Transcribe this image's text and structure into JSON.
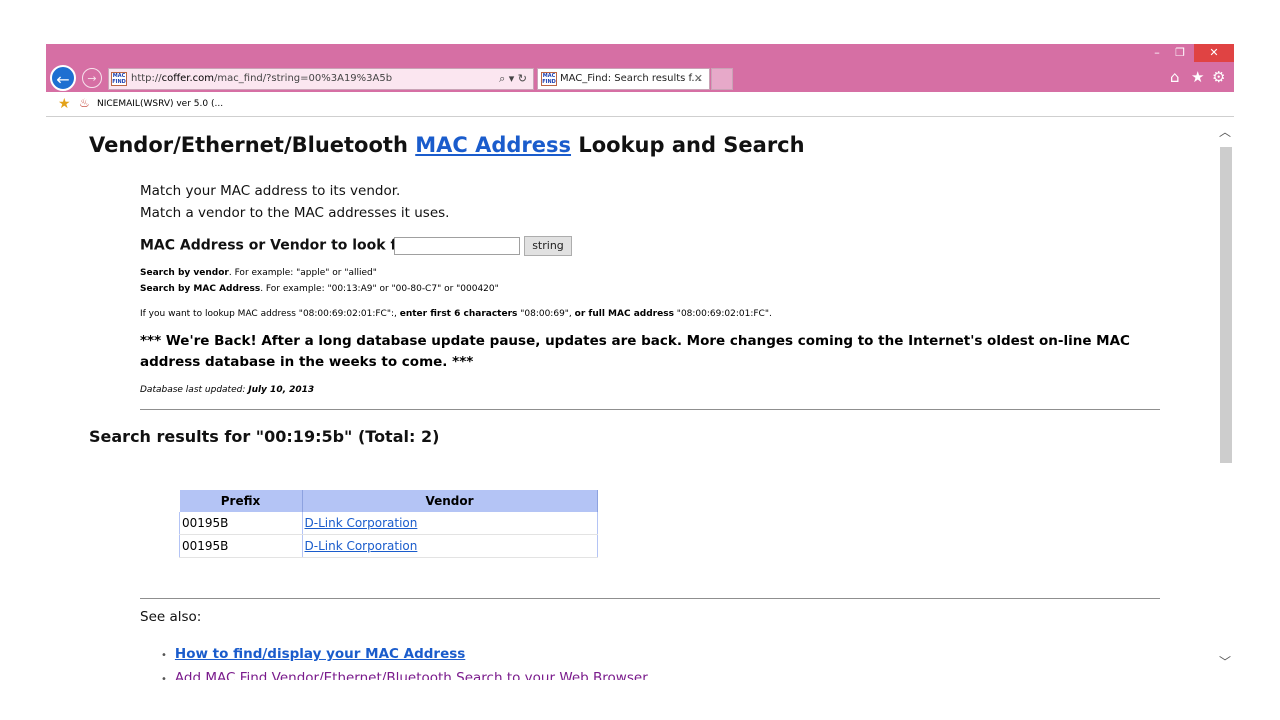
{
  "window": {
    "minimize": "–",
    "maximize": "❐",
    "close": "✕"
  },
  "address_bar": {
    "favicon_text": "MAC FIND",
    "url_prefix": "http://",
    "url_domain": "coffer.com",
    "url_path": "/mac_find/?string=00%3A19%3A5b",
    "tools": "⌕ ▾ ↻"
  },
  "tab": {
    "favicon_text": "MAC FIND",
    "title": "MAC_Find: Search results f...",
    "close": "✕"
  },
  "toolbar_icons": {
    "home": "⌂",
    "favorites": "★",
    "settings": "⚙"
  },
  "favorites_bar": {
    "item": "NICEMAIL(WSRV) ver 5.0 (..."
  },
  "page": {
    "title_before": "Vendor/Ethernet/Bluetooth ",
    "title_link": "MAC Address",
    "title_after": " Lookup and Search",
    "intro_line1": "Match your MAC address to its vendor.",
    "intro_line2": "Match a vendor to the MAC addresses it uses.",
    "form_label": "MAC Address or Vendor to look for",
    "form_colon": ":",
    "search_value": "",
    "search_button": "string",
    "hint_vendor_bold": "Search by vendor",
    "hint_vendor_rest": ". For example: \"apple\" or \"allied\"",
    "hint_mac_bold": "Search by MAC Address",
    "hint_mac_rest": ". For example: \"00:13:A9\" or \"00-80-C7\" or \"000420\"",
    "lookup_1": "If you want to lookup MAC address \"08:00:69:02:01:FC\":, ",
    "lookup_2_bold": "enter first 6 characters",
    "lookup_3": " \"08:00:69\", ",
    "lookup_4_bold": "or full MAC address",
    "lookup_5": " \"08:00:69:02:01:FC\".",
    "notice": "*** We're Back! After a long database update pause, updates are back. More changes coming to the Internet's oldest on-line MAC address database in the weeks to come. ***",
    "updated_label": "Database last updated: ",
    "updated_date": "July 10, 2013",
    "results_heading": "Search results for \"00:19:5b\" (Total: 2)",
    "table": {
      "headers": [
        "Prefix",
        "Vendor"
      ],
      "rows": [
        {
          "prefix": "00195B",
          "vendor": "D-Link Corporation"
        },
        {
          "prefix": "00195B",
          "vendor": "D-Link Corporation"
        }
      ]
    },
    "see_also": "See also:",
    "links": [
      "How to find/display your MAC Address",
      "Add MAC Find Vendor/Ethernet/Bluetooth Search to your Web Browser"
    ],
    "bullet": "•"
  },
  "scrollbar": {
    "up": "︿",
    "down": "﹀"
  },
  "colors": {
    "chrome": "#d66fa4",
    "link": "#1a5ccc",
    "visited": "#7a1b8c",
    "table_header": "#b4c4f5"
  }
}
